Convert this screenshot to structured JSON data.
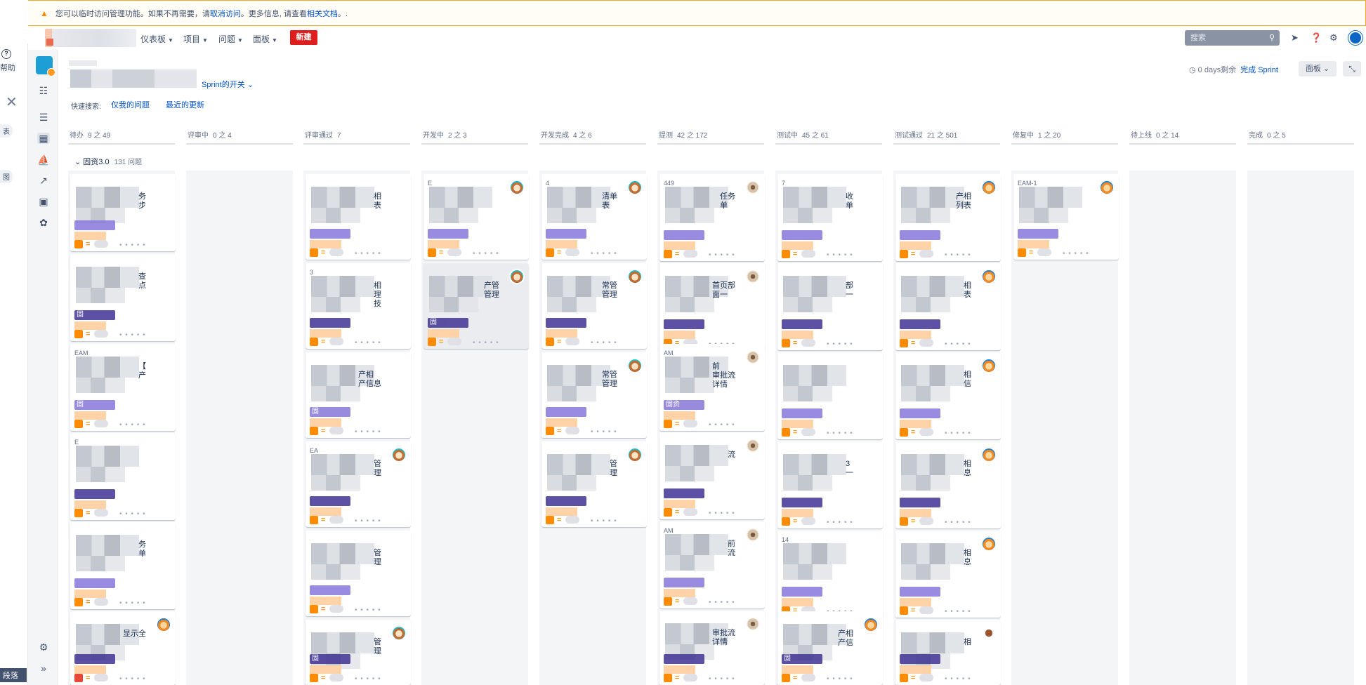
{
  "banner": {
    "text_before": "您可以临时访问管理功能。如果不再需要，请",
    "cancel_link": "取消访问",
    "text_mid": "。更多信息, 请查看",
    "docs_link": "相关文档",
    "text_after": "。."
  },
  "left_panel": {
    "help_label": "帮助",
    "frag_1": "表",
    "frag_2": "图",
    "bottom_tag": "段落"
  },
  "topnav": {
    "items": [
      "仪表板",
      "项目",
      "问题",
      "面板"
    ],
    "create_label": "新建",
    "search_placeholder": "搜索"
  },
  "board": {
    "sprint_selector": "Sprint的开关",
    "quick_filter_label": "快速搜索:",
    "quick_filters": [
      "仅我的问题",
      "最近的更新"
    ],
    "days_remaining": "0 days剩余",
    "complete_sprint": "完成 Sprint",
    "board_button": "面板",
    "swimlane": {
      "title": "固资3.0",
      "count": "131 问题"
    },
    "columns": [
      {
        "name": "待办",
        "count": "9 之 49"
      },
      {
        "name": "评审中",
        "count": "0 之 4"
      },
      {
        "name": "评审通过",
        "count": "7"
      },
      {
        "name": "开发中",
        "count": "2 之 3"
      },
      {
        "name": "开发完成",
        "count": "4 之 6"
      },
      {
        "name": "提测",
        "count": "42 之 172"
      },
      {
        "name": "测试中",
        "count": "45 之 61"
      },
      {
        "name": "测试通过",
        "count": "21 之 501"
      },
      {
        "name": "修复中",
        "count": "1 之 20"
      },
      {
        "name": "待上线",
        "count": "0 之 14"
      },
      {
        "name": "完成",
        "count": "0 之 5"
      }
    ],
    "cards": {
      "c0_0": {
        "key": "",
        "summary": "务\n步"
      },
      "c0_1": {
        "key": "",
        "summary": "查\n点",
        "epic": "固"
      },
      "c0_2": {
        "key": "EAM",
        "summary": "【\n产",
        "epic": "固"
      },
      "c0_3": {
        "key": "E",
        "summary": ""
      },
      "c0_4": {
        "key": "",
        "summary": "务\n单"
      },
      "c0_5": {
        "key": "",
        "summary": "显示全"
      },
      "c2_0": {
        "key": "",
        "summary": "相\n表"
      },
      "c2_1": {
        "key": "3",
        "summary": "相\n理\n技"
      },
      "c2_2": {
        "key": "",
        "summary": "产相\n产信息",
        "epic": "固"
      },
      "c2_3": {
        "key": "EA",
        "summary": "管\n理"
      },
      "c2_4": {
        "key": "",
        "summary": "管\n理"
      },
      "c2_5": {
        "key": "",
        "summary": "管\n理",
        "epic": "固"
      },
      "c3_0": {
        "key": "E",
        "summary": ""
      },
      "c3_1": {
        "key": "",
        "summary": "产管\n管理",
        "epic": "固"
      },
      "c4_0": {
        "key": "4",
        "summary": "清单\n表"
      },
      "c4_1": {
        "key": "",
        "summary": "常管\n管理"
      },
      "c4_2": {
        "key": "",
        "summary": "常管\n管理"
      },
      "c4_3": {
        "key": "",
        "summary": "管\n理"
      },
      "c5_0": {
        "key": "449",
        "summary": "任务\n单"
      },
      "c5_1": {
        "key": "",
        "summary": "首页部\n面一"
      },
      "c5_2": {
        "key": "AM",
        "summary": "前\n审批流\n详情",
        "epic": "固资"
      },
      "c5_3": {
        "key": "",
        "summary": "流"
      },
      "c5_4": {
        "key": "AM",
        "summary": "前\n流"
      },
      "c5_5": {
        "key": "",
        "summary": "审批流\n详情"
      },
      "c6_0": {
        "key": "7",
        "summary": "收\n单"
      },
      "c6_1": {
        "key": "",
        "summary": "部\n一"
      },
      "c6_2": {
        "key": "",
        "summary": ""
      },
      "c6_3": {
        "key": "",
        "summary": "3\n一"
      },
      "c6_4": {
        "key": "14",
        "summary": ""
      },
      "c6_5": {
        "key": "",
        "summary": "产相\n产信",
        "epic": "固"
      },
      "c7_0": {
        "key": "",
        "summary": "产相\n列表"
      },
      "c7_1": {
        "key": "",
        "summary": "相\n表"
      },
      "c7_2": {
        "key": "",
        "summary": "相\n信"
      },
      "c7_3": {
        "key": "",
        "summary": "相\n息"
      },
      "c7_4": {
        "key": "",
        "summary": "相\n息"
      },
      "c7_5": {
        "key": "",
        "summary": "相"
      },
      "c8_0": {
        "key": "EAM-1",
        "summary": ""
      }
    }
  },
  "colors": {
    "accent": "#0052cc",
    "create_button": "#de1e1e",
    "epic": "#8777d9",
    "banner_border": "#f5a623"
  }
}
